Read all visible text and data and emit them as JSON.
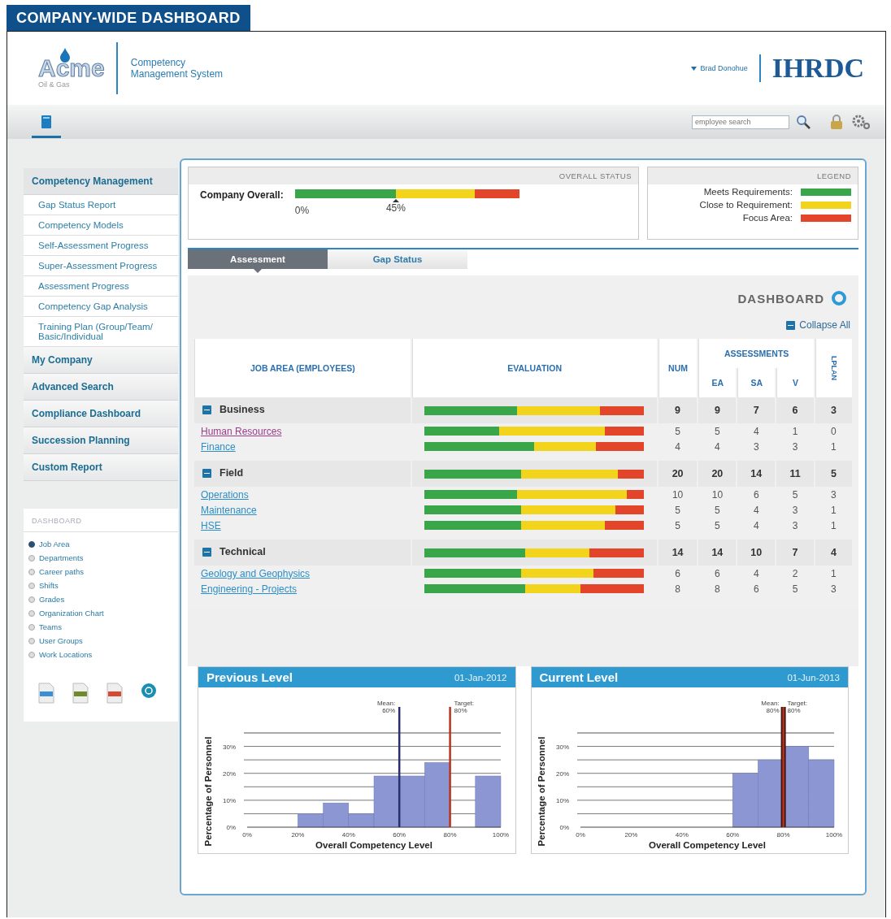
{
  "page_title": "COMPANY-WIDE DASHBOARD",
  "header": {
    "logo": {
      "name": "Acme",
      "tagline": "Oil & Gas"
    },
    "app_name": [
      "Competency",
      "Management System"
    ],
    "user": "Brad Donohue",
    "brand": "IHRDC"
  },
  "toolbar": {
    "search": {
      "placeholder": "employee search"
    }
  },
  "sidebar": {
    "sections": [
      {
        "label": "Competency Management",
        "expanded": true,
        "items": [
          "Gap Status Report",
          "Competency Models",
          "Self-Assessment Progress",
          "Super-Assessment Progress",
          "Assessment Progress",
          "Competency Gap Analysis",
          "Training Plan (Group/Team/ Basic/Individual"
        ]
      },
      {
        "label": "My Company",
        "expanded": false
      },
      {
        "label": "Advanced Search",
        "expanded": false
      },
      {
        "label": "Compliance Dashboard",
        "expanded": false
      },
      {
        "label": "Succession Planning",
        "expanded": false
      },
      {
        "label": "Custom Report",
        "expanded": false
      }
    ],
    "dashboard": {
      "title": "DASHBOARD",
      "options": [
        {
          "label": "Job Area",
          "selected": true
        },
        {
          "label": "Departments",
          "selected": false
        },
        {
          "label": "Career paths",
          "selected": false
        },
        {
          "label": "Shifts",
          "selected": false
        },
        {
          "label": "Grades",
          "selected": false
        },
        {
          "label": "Organization Chart",
          "selected": false
        },
        {
          "label": "Teams",
          "selected": false
        },
        {
          "label": "User Groups",
          "selected": false
        },
        {
          "label": "Work Locations",
          "selected": false
        }
      ],
      "exports": [
        {
          "kind": "doc",
          "color": "#3a8fd6"
        },
        {
          "kind": "doc",
          "color": "#6f8a2a"
        },
        {
          "kind": "doc",
          "color": "#d64a32"
        },
        {
          "kind": "circle",
          "color": "#1a8fb0"
        }
      ]
    }
  },
  "overall_status": {
    "title": "OVERALL STATUS",
    "label": "Company Overall:",
    "meets": {
      "level": 0.45
    },
    "focus": {
      "level": 0.2
    },
    "scale_start": "0%",
    "marker_value": "45%"
  },
  "legend": {
    "title": "LEGEND",
    "items": [
      {
        "label": "Meets Requirements:",
        "color": "#3aa64a"
      },
      {
        "label": "Close to Requirement:",
        "color": "#f2d41c"
      },
      {
        "label": "Focus Area:",
        "color": "#e2452a"
      }
    ]
  },
  "tabs": [
    {
      "label": "Assessment",
      "selected": true
    },
    {
      "label": "Gap Status",
      "selected": false
    }
  ],
  "dashboard_title": "DASHBOARD",
  "collapse_all": "Collapse All",
  "table": {
    "columns": {
      "job_area": "JOB AREA (EMPLOYEES)",
      "evaluation": "EVALUATION",
      "num": "NUM",
      "assessments": "ASSESSMENTS",
      "ea": "EA",
      "sa": "SA",
      "v": "V",
      "lplan": "LPLAN"
    },
    "groups": [
      {
        "name": "Business",
        "expanded": true,
        "meets": {
          "level": 0.42
        },
        "focus": {
          "level": 0.2
        },
        "num": "9",
        "ea": "9",
        "sa": "7",
        "v": "6",
        "lplan": "3",
        "rows": [
          {
            "name": "Human Resources",
            "visited": true,
            "meets": {
              "level": 0.34
            },
            "focus": {
              "level": 0.18
            },
            "num": "5",
            "ea": "5",
            "sa": "4",
            "v": "1",
            "lplan": "0"
          },
          {
            "name": "Finance",
            "visited": false,
            "meets": {
              "level": 0.5
            },
            "focus": {
              "level": 0.22
            },
            "num": "4",
            "ea": "4",
            "sa": "3",
            "v": "3",
            "lplan": "1"
          }
        ]
      },
      {
        "name": "Field",
        "expanded": true,
        "meets": {
          "level": 0.44
        },
        "focus": {
          "level": 0.12
        },
        "num": "20",
        "ea": "20",
        "sa": "14",
        "v": "11",
        "lplan": "5",
        "rows": [
          {
            "name": "Operations",
            "visited": false,
            "meets": {
              "level": 0.42
            },
            "focus": {
              "level": 0.08
            },
            "num": "10",
            "ea": "10",
            "sa": "6",
            "v": "5",
            "lplan": "3"
          },
          {
            "name": "Maintenance",
            "visited": false,
            "meets": {
              "level": 0.44
            },
            "focus": {
              "level": 0.13
            },
            "num": "5",
            "ea": "5",
            "sa": "4",
            "v": "3",
            "lplan": "1"
          },
          {
            "name": "HSE",
            "visited": false,
            "meets": {
              "level": 0.44
            },
            "focus": {
              "level": 0.18
            },
            "num": "5",
            "ea": "5",
            "sa": "4",
            "v": "3",
            "lplan": "1"
          }
        ]
      },
      {
        "name": "Technical",
        "expanded": true,
        "meets": {
          "level": 0.46
        },
        "focus": {
          "level": 0.25
        },
        "num": "14",
        "ea": "14",
        "sa": "10",
        "v": "7",
        "lplan": "4",
        "rows": [
          {
            "name": "Geology and Geophysics",
            "visited": false,
            "meets": {
              "level": 0.44
            },
            "focus": {
              "level": 0.23
            },
            "num": "6",
            "ea": "6",
            "sa": "4",
            "v": "2",
            "lplan": "1"
          },
          {
            "name": "Engineering - Projects",
            "visited": false,
            "meets": {
              "level": 0.46
            },
            "focus": {
              "level": 0.29
            },
            "num": "8",
            "ea": "8",
            "sa": "6",
            "v": "5",
            "lplan": "3"
          }
        ]
      }
    ]
  },
  "charts": [
    {
      "title": "Previous Level",
      "date": "01-Jan-2012",
      "chart_data": {
        "type": "bar",
        "xlabel": "Overall Competency Level",
        "ylabel": "Percentage of Personnel",
        "x": [
          5,
          15,
          25,
          35,
          45,
          55,
          65,
          75,
          85,
          95
        ],
        "series": [
          {
            "color": "#8c96d2",
            "values": [
              0,
              0,
              5,
              9,
              5,
              19,
              19,
              24,
              0,
              19
            ]
          }
        ],
        "xlim": [
          0,
          100
        ],
        "ylim": [
          0,
          35
        ],
        "grid": true,
        "xticks": [
          {
            "value": 0,
            "label": "0%"
          },
          {
            "value": 20,
            "label": "20%"
          },
          {
            "value": 40,
            "label": "40%"
          },
          {
            "value": 60,
            "label": "60%"
          },
          {
            "value": 80,
            "label": "80%"
          },
          {
            "value": 100,
            "label": "100%"
          }
        ],
        "yticks": [
          {
            "value": 0,
            "label": "0%"
          },
          {
            "value": 10,
            "label": "10%"
          },
          {
            "value": 20,
            "label": "20%"
          },
          {
            "value": 30,
            "label": "30%"
          }
        ],
        "ref_lines": [
          {
            "axis": "x",
            "value": 60,
            "label": "Mean: 60%",
            "color": "#2b2f6b"
          },
          {
            "axis": "x",
            "value": 80,
            "label": "Target: 80%",
            "color": "#b8321e"
          }
        ]
      }
    },
    {
      "title": "Current Level",
      "date": "01-Jun-2013",
      "chart_data": {
        "type": "bar",
        "xlabel": "Overall Competency Level",
        "ylabel": "Percentage of Personnel",
        "x": [
          5,
          15,
          25,
          35,
          45,
          55,
          65,
          75,
          85,
          95
        ],
        "series": [
          {
            "color": "#8c96d2",
            "values": [
              0,
              0,
              0,
              0,
              0,
              0,
              20,
              25,
              30,
              25
            ]
          }
        ],
        "xlim": [
          0,
          100
        ],
        "ylim": [
          0,
          35
        ],
        "grid": true,
        "xticks": [
          {
            "value": 0,
            "label": "0%"
          },
          {
            "value": 20,
            "label": "20%"
          },
          {
            "value": 40,
            "label": "40%"
          },
          {
            "value": 60,
            "label": "60%"
          },
          {
            "value": 80,
            "label": "80%"
          },
          {
            "value": 100,
            "label": "100%"
          }
        ],
        "yticks": [
          {
            "value": 0,
            "label": "0%"
          },
          {
            "value": 10,
            "label": "10%"
          },
          {
            "value": 20,
            "label": "20%"
          },
          {
            "value": 30,
            "label": "30%"
          }
        ],
        "ref_lines": [
          {
            "axis": "x",
            "value": 80,
            "label": "Mean: 80%",
            "color": "#3a1410"
          },
          {
            "axis": "x",
            "value": 80,
            "label": "Target: 80%",
            "color": "#b8321e"
          }
        ]
      }
    }
  ]
}
